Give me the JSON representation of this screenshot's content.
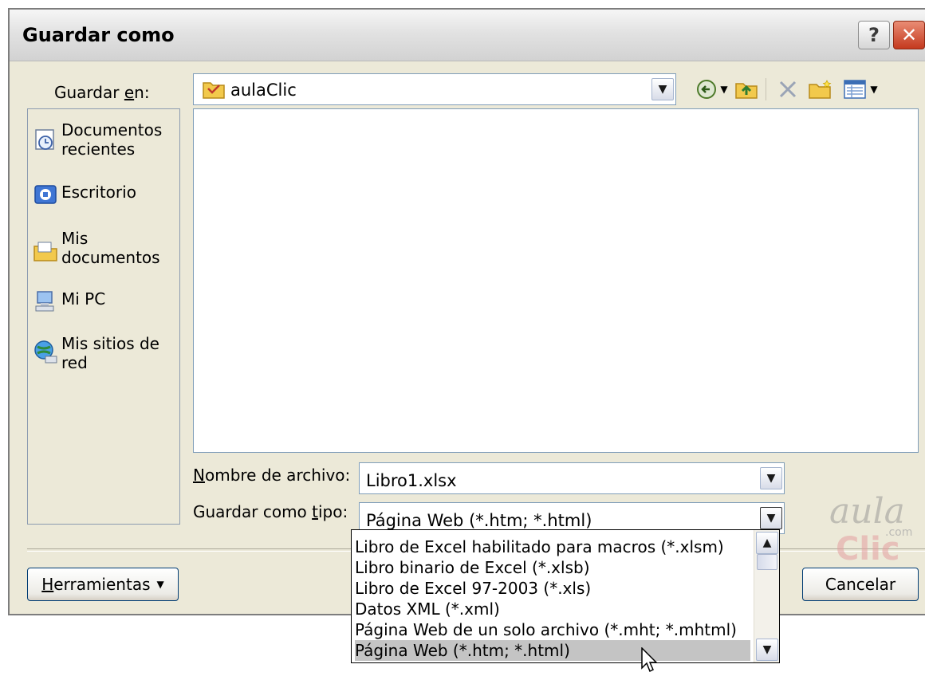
{
  "window": {
    "title": "Guardar como",
    "help_glyph": "?",
    "close_glyph": "✕"
  },
  "save_in": {
    "label_pre": "Guardar ",
    "label_key": "e",
    "label_post": "n:",
    "value": "aulaClic"
  },
  "places": [
    {
      "label": "Documentos recientes",
      "icon": "recent-documents-icon"
    },
    {
      "label": "Escritorio",
      "icon": "desktop-icon"
    },
    {
      "label": "Mis documentos",
      "icon": "my-documents-icon"
    },
    {
      "label": "Mi PC",
      "icon": "my-computer-icon"
    },
    {
      "label": "Mis sitios de red",
      "icon": "network-places-icon"
    }
  ],
  "filename": {
    "label_key": "N",
    "label_post": "ombre de archivo:",
    "value": "Libro1.xlsx"
  },
  "filetype": {
    "label_pre": "Guardar como ",
    "label_key": "t",
    "label_post": "ipo:",
    "value": "Página Web (*.htm; *.html)"
  },
  "type_options": [
    "Libro de Excel habilitado para macros (*.xlsm)",
    "Libro binario de Excel (*.xlsb)",
    "Libro de Excel 97-2003 (*.xls)",
    "Datos XML (*.xml)",
    "Página Web de un solo archivo (*.mht; *.mhtml)",
    "Página Web (*.htm; *.html)"
  ],
  "selected_option_index": 5,
  "buttons": {
    "tools_key": "H",
    "tools_post": "erramientas",
    "cancel": "Cancelar"
  },
  "watermark": {
    "text": "aula",
    "brand": "Clic",
    "suffix": ".com"
  }
}
